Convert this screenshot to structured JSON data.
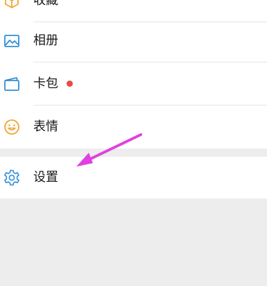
{
  "menu": {
    "favorites_label": "收藏",
    "album_label": "相册",
    "cards_label": "卡包",
    "stickers_label": "表情",
    "settings_label": "设置"
  },
  "icons": {
    "favorites": "favorites-cube-icon",
    "album": "album-picture-icon",
    "cards": "card-wallet-icon",
    "stickers": "smiley-face-icon",
    "settings": "gear-icon"
  },
  "colors": {
    "favorites_icon": "#f3a533",
    "album_icon": "#2f8fd8",
    "cards_icon": "#2f8fd8",
    "stickers_icon": "#f3a533",
    "settings_icon": "#2f8fd8",
    "badge": "#e84a4a",
    "annotation_arrow": "#e040e0"
  }
}
